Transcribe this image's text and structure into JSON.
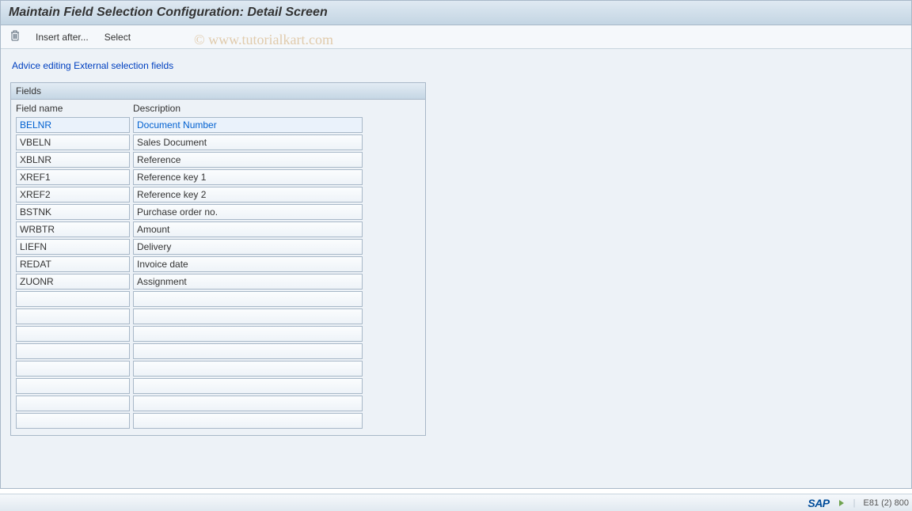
{
  "title": "Maintain Field Selection Configuration: Detail Screen",
  "toolbar": {
    "insert_after_label": "Insert after...",
    "select_label": "Select"
  },
  "link_row": {
    "advice_editing": "Advice editing",
    "external_selection": "External selection fields"
  },
  "panel": {
    "title": "Fields",
    "col_fieldname": "Field name",
    "col_description": "Description"
  },
  "rows": [
    {
      "field": "BELNR",
      "desc": "Document Number",
      "selected": true
    },
    {
      "field": "VBELN",
      "desc": "Sales Document",
      "selected": false
    },
    {
      "field": "XBLNR",
      "desc": "Reference",
      "selected": false
    },
    {
      "field": "XREF1",
      "desc": "Reference key 1",
      "selected": false
    },
    {
      "field": "XREF2",
      "desc": "Reference key 2",
      "selected": false
    },
    {
      "field": "BSTNK",
      "desc": "Purchase order no.",
      "selected": false
    },
    {
      "field": "WRBTR",
      "desc": "Amount",
      "selected": false
    },
    {
      "field": "LIEFN",
      "desc": "Delivery",
      "selected": false
    },
    {
      "field": "REDAT",
      "desc": "Invoice date",
      "selected": false
    },
    {
      "field": "ZUONR",
      "desc": "Assignment",
      "selected": false
    },
    {
      "field": "",
      "desc": "",
      "selected": false
    },
    {
      "field": "",
      "desc": "",
      "selected": false
    },
    {
      "field": "",
      "desc": "",
      "selected": false
    },
    {
      "field": "",
      "desc": "",
      "selected": false
    },
    {
      "field": "",
      "desc": "",
      "selected": false
    },
    {
      "field": "",
      "desc": "",
      "selected": false
    },
    {
      "field": "",
      "desc": "",
      "selected": false
    },
    {
      "field": "",
      "desc": "",
      "selected": false
    }
  ],
  "statusbar": {
    "sap_logo": "SAP",
    "system_info": "E81 (2) 800"
  },
  "watermark": "© www.tutorialkart.com"
}
